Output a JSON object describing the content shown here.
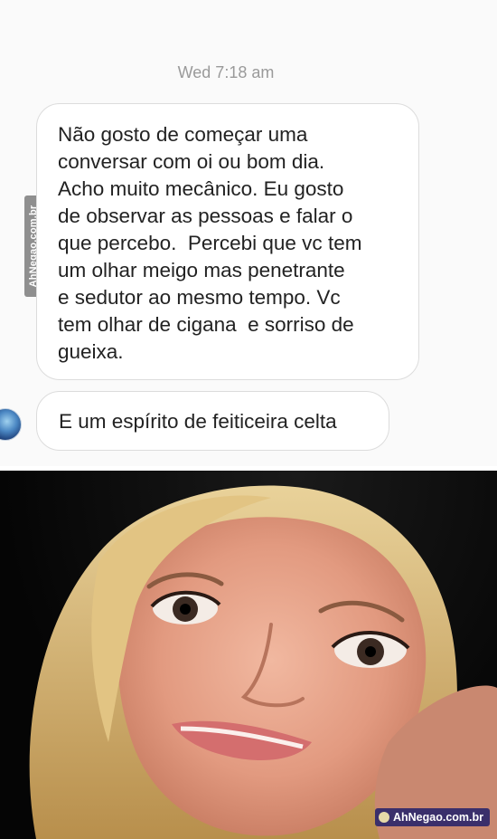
{
  "chat": {
    "timestamp": "Wed 7:18 am",
    "messages": [
      {
        "lines": [
          "Não gosto de começar uma",
          "conversar com oi ou bom dia.",
          "Acho muito mecânico. Eu gosto",
          "de observar as pessoas e falar o",
          "que percebo.  Percebi que vc tem",
          "um olhar meigo mas penetrante",
          "e sedutor ao mesmo tempo. Vc",
          "tem olhar de cigana  e sorriso de",
          "gueixa."
        ]
      },
      {
        "text": "E um espírito de feiticeira celta"
      }
    ],
    "side_watermark": "AhNegao.com.br"
  },
  "photo": {
    "watermark": "AhNegao.com.br"
  },
  "colors": {
    "chat_bg": "#fafafa",
    "bubble_border": "#dcdcdc",
    "timestamp": "#9a9a9a",
    "badge_bg": "#3a2f6b"
  }
}
